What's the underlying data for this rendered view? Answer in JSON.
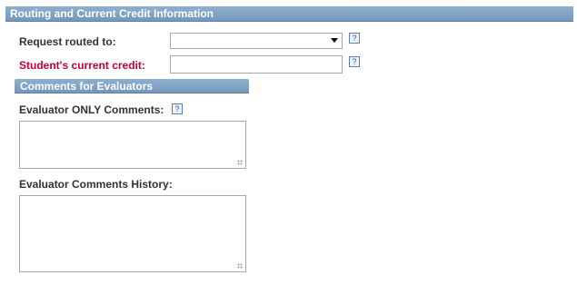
{
  "section": {
    "title": "Routing and Current Credit Information"
  },
  "routing": {
    "label": "Request routed to:",
    "selected_value": "",
    "help": "?"
  },
  "credit": {
    "label": "Student's current credit:",
    "value": "",
    "help": "?"
  },
  "comments": {
    "header": "Comments for Evaluators",
    "evaluator_only_label": "Evaluator ONLY Comments:",
    "evaluator_only_help": "?",
    "evaluator_only_value": "",
    "history_label": "Evaluator Comments History:",
    "history_value": ""
  },
  "colors": {
    "header_bg": "#7f9fc3",
    "required_label": "#c4003a"
  }
}
